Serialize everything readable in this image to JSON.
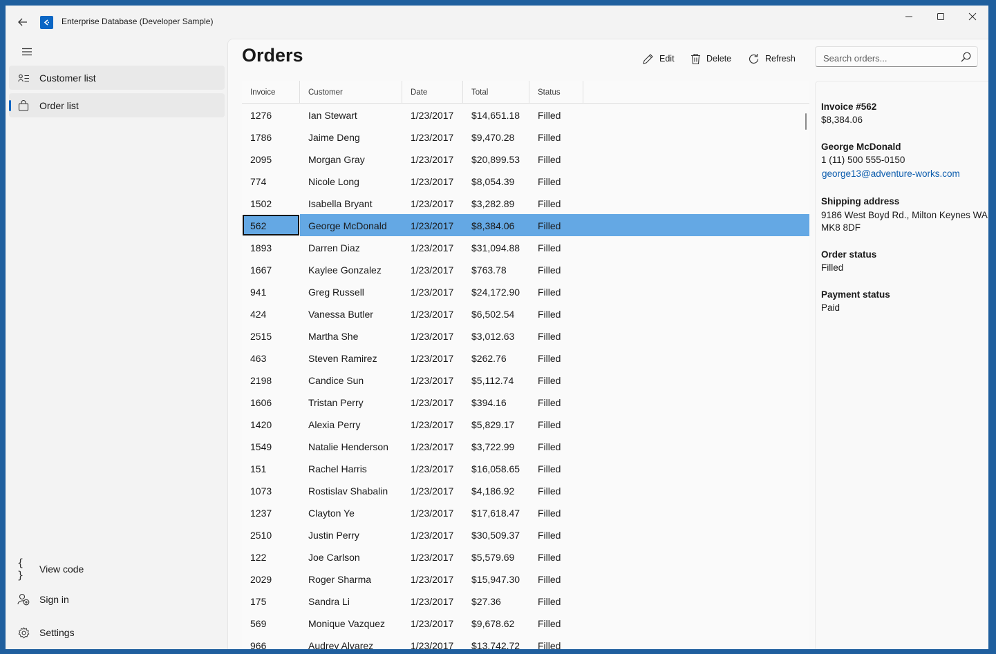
{
  "window": {
    "title": "Enterprise Database (Developer Sample)"
  },
  "nav": {
    "items": [
      {
        "label": "Customer list",
        "icon": "contact-list-icon"
      },
      {
        "label": "Order list",
        "icon": "shopping-bag-icon",
        "selected": true
      }
    ],
    "footer": [
      {
        "label": "View code",
        "icon": "code-braces-icon"
      },
      {
        "label": "Sign in",
        "icon": "add-user-icon"
      },
      {
        "label": "Settings",
        "icon": "gear-icon"
      }
    ]
  },
  "page": {
    "title": "Orders"
  },
  "commands": {
    "edit": "Edit",
    "delete": "Delete",
    "refresh": "Refresh"
  },
  "search": {
    "placeholder": "Search orders..."
  },
  "grid": {
    "columns": [
      "Invoice",
      "Customer",
      "Date",
      "Total",
      "Status"
    ],
    "selected_index": 5,
    "rows": [
      [
        "1276",
        "Ian Stewart",
        "1/23/2017",
        "$14,651.18",
        "Filled"
      ],
      [
        "1786",
        "Jaime Deng",
        "1/23/2017",
        "$9,470.28",
        "Filled"
      ],
      [
        "2095",
        "Morgan Gray",
        "1/23/2017",
        "$20,899.53",
        "Filled"
      ],
      [
        "774",
        "Nicole Long",
        "1/23/2017",
        "$8,054.39",
        "Filled"
      ],
      [
        "1502",
        "Isabella Bryant",
        "1/23/2017",
        "$3,282.89",
        "Filled"
      ],
      [
        "562",
        "George McDonald",
        "1/23/2017",
        "$8,384.06",
        "Filled"
      ],
      [
        "1893",
        "Darren Diaz",
        "1/23/2017",
        "$31,094.88",
        "Filled"
      ],
      [
        "1667",
        "Kaylee Gonzalez",
        "1/23/2017",
        "$763.78",
        "Filled"
      ],
      [
        "941",
        "Greg Russell",
        "1/23/2017",
        "$24,172.90",
        "Filled"
      ],
      [
        "424",
        "Vanessa Butler",
        "1/23/2017",
        "$6,502.54",
        "Filled"
      ],
      [
        "2515",
        "Martha She",
        "1/23/2017",
        "$3,012.63",
        "Filled"
      ],
      [
        "463",
        "Steven Ramirez",
        "1/23/2017",
        "$262.76",
        "Filled"
      ],
      [
        "2198",
        "Candice Sun",
        "1/23/2017",
        "$5,112.74",
        "Filled"
      ],
      [
        "1606",
        "Tristan Perry",
        "1/23/2017",
        "$394.16",
        "Filled"
      ],
      [
        "1420",
        "Alexia Perry",
        "1/23/2017",
        "$5,829.17",
        "Filled"
      ],
      [
        "1549",
        "Natalie Henderson",
        "1/23/2017",
        "$3,722.99",
        "Filled"
      ],
      [
        "151",
        "Rachel Harris",
        "1/23/2017",
        "$16,058.65",
        "Filled"
      ],
      [
        "1073",
        "Rostislav Shabalin",
        "1/23/2017",
        "$4,186.92",
        "Filled"
      ],
      [
        "1237",
        "Clayton Ye",
        "1/23/2017",
        "$17,618.47",
        "Filled"
      ],
      [
        "2510",
        "Justin Perry",
        "1/23/2017",
        "$30,509.37",
        "Filled"
      ],
      [
        "122",
        "Joe Carlson",
        "1/23/2017",
        "$5,579.69",
        "Filled"
      ],
      [
        "2029",
        "Roger Sharma",
        "1/23/2017",
        "$15,947.30",
        "Filled"
      ],
      [
        "175",
        "Sandra Li",
        "1/23/2017",
        "$27.36",
        "Filled"
      ],
      [
        "569",
        "Monique Vazquez",
        "1/23/2017",
        "$9,678.62",
        "Filled"
      ],
      [
        "966",
        "Audrey Alvarez",
        "1/23/2017",
        "$13,742.72",
        "Filled"
      ]
    ]
  },
  "details": {
    "invoice": "Invoice #562",
    "total": "$8,384.06",
    "customer_name": "George McDonald",
    "phone": "1 (11) 500 555-0150",
    "email": "george13@adventure-works.com",
    "shipping_label": "Shipping address",
    "shipping_line1": "9186 West Boyd Rd., Milton Keynes WA",
    "shipping_line2": "MK8 8DF",
    "order_status_label": "Order status",
    "order_status": "Filled",
    "payment_status_label": "Payment status",
    "payment_status": "Paid"
  },
  "colors": {
    "accent": "#0b66c4",
    "selected_row": "#64a8e4",
    "link": "#0b5cad"
  }
}
